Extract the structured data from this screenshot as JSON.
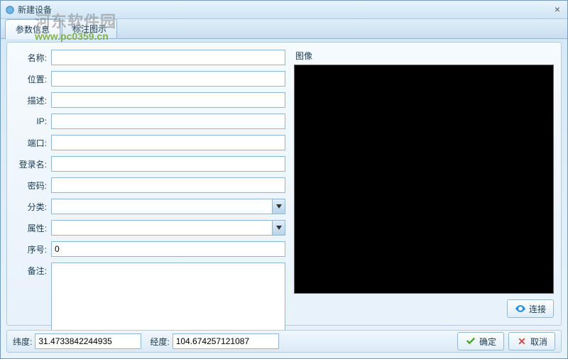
{
  "window": {
    "title": "新建设备"
  },
  "tabs": {
    "param_info": "参数信息",
    "annotation": "标注图示"
  },
  "form": {
    "name": {
      "label": "名称:",
      "value": ""
    },
    "position": {
      "label": "位置:",
      "value": ""
    },
    "description": {
      "label": "描述:",
      "value": ""
    },
    "ip": {
      "label": "IP:",
      "value": ""
    },
    "port": {
      "label": "端口:",
      "value": ""
    },
    "login": {
      "label": "登录名:",
      "value": ""
    },
    "password": {
      "label": "密码:",
      "value": ""
    },
    "category": {
      "label": "分类:",
      "value": ""
    },
    "attribute": {
      "label": "属性:",
      "value": ""
    },
    "serial": {
      "label": "序号:",
      "value": "0"
    },
    "remark": {
      "label": "备注:",
      "value": ""
    }
  },
  "image": {
    "label": "图像",
    "connect_btn": "连接"
  },
  "footer": {
    "lat_label": "纬度:",
    "lat_value": "31.4733842244935",
    "lng_label": "经度:",
    "lng_value": "104.674257121087",
    "ok": "确定",
    "cancel": "取消"
  },
  "watermark": {
    "line1": "河东软件园",
    "line2": "www.pc0359.cn"
  }
}
